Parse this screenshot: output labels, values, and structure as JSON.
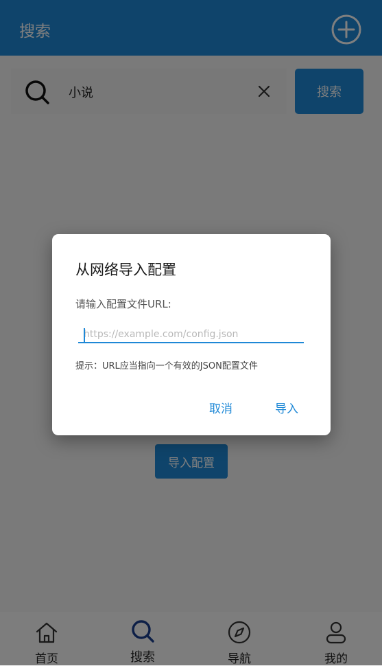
{
  "app_bar": {
    "title": "搜索",
    "add_icon": "plus-circle-icon"
  },
  "search": {
    "query": "小说",
    "button_label": "搜索",
    "search_icon": "search-icon",
    "clear_icon": "close-icon"
  },
  "main": {
    "import_button_label": "导入配置"
  },
  "dialog": {
    "title": "从网络导入配置",
    "label": "请输入配置文件URL:",
    "input_value": "",
    "input_placeholder": "https://example.com/config.json",
    "hint": "提示：URL应当指向一个有效的JSON配置文件",
    "cancel_label": "取消",
    "confirm_label": "导入"
  },
  "bottom_nav": {
    "items": [
      {
        "label": "首页",
        "icon": "home-icon",
        "active": false
      },
      {
        "label": "搜索",
        "icon": "search-icon",
        "active": true
      },
      {
        "label": "导航",
        "icon": "compass-icon",
        "active": false
      },
      {
        "label": "我的",
        "icon": "user-icon",
        "active": false
      }
    ]
  },
  "colors": {
    "primary": "#1e88d6",
    "scrim": "rgba(0,0,0,0.5)",
    "text_dark": "#222222",
    "active_nav_icon": "#1a3f8f"
  }
}
